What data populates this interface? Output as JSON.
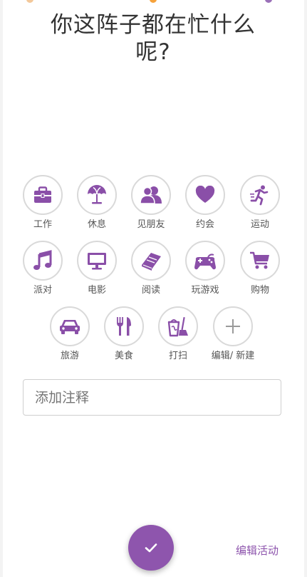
{
  "title": "你这阵子都在忙什么呢?",
  "colors": {
    "accent": "#8e55ad",
    "icon": "#8a4fa8"
  },
  "activities": [
    {
      "label": "工作",
      "icon": "briefcase-icon"
    },
    {
      "label": "休息",
      "icon": "beach-umbrella-icon"
    },
    {
      "label": "见朋友",
      "icon": "friends-icon"
    },
    {
      "label": "约会",
      "icon": "heart-icon"
    },
    {
      "label": "运动",
      "icon": "running-icon"
    },
    {
      "label": "派对",
      "icon": "music-note-icon"
    },
    {
      "label": "电影",
      "icon": "tv-icon"
    },
    {
      "label": "阅读",
      "icon": "book-icon"
    },
    {
      "label": "玩游戏",
      "icon": "gamepad-icon"
    },
    {
      "label": "购物",
      "icon": "shopping-cart-icon"
    },
    {
      "label": "旅游",
      "icon": "car-icon"
    },
    {
      "label": "美食",
      "icon": "fork-knife-icon"
    },
    {
      "label": "打扫",
      "icon": "cleaning-icon"
    },
    {
      "label": "编辑/ 新建",
      "icon": "plus-icon"
    }
  ],
  "note": {
    "placeholder": "添加注释"
  },
  "confirm": {
    "icon": "checkmark-icon"
  },
  "edit_activities": "编辑活动"
}
